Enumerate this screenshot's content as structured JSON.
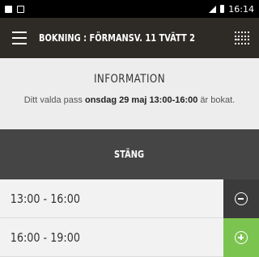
{
  "status_bar": {
    "time": "16:14"
  },
  "header": {
    "title": "BOKNING : FÖRMANSV. 11 TVÄTT 2",
    "chevron": "⌄"
  },
  "info": {
    "heading": "INFORMATION",
    "text_prefix": "Ditt valda pass ",
    "text_bold": "onsdag 29 maj 13:00-16:00",
    "text_suffix": " är bokat."
  },
  "close_button_label": "STÄNG",
  "slots": [
    {
      "time": "13:00 - 16:00",
      "action": "remove"
    },
    {
      "time": "16:00 - 19:00",
      "action": "add"
    }
  ],
  "colors": {
    "header_bg": "#2e2a26",
    "close_bar_bg": "#454545",
    "remove_bg": "#3b3b3b",
    "add_bg": "#7cc450"
  }
}
